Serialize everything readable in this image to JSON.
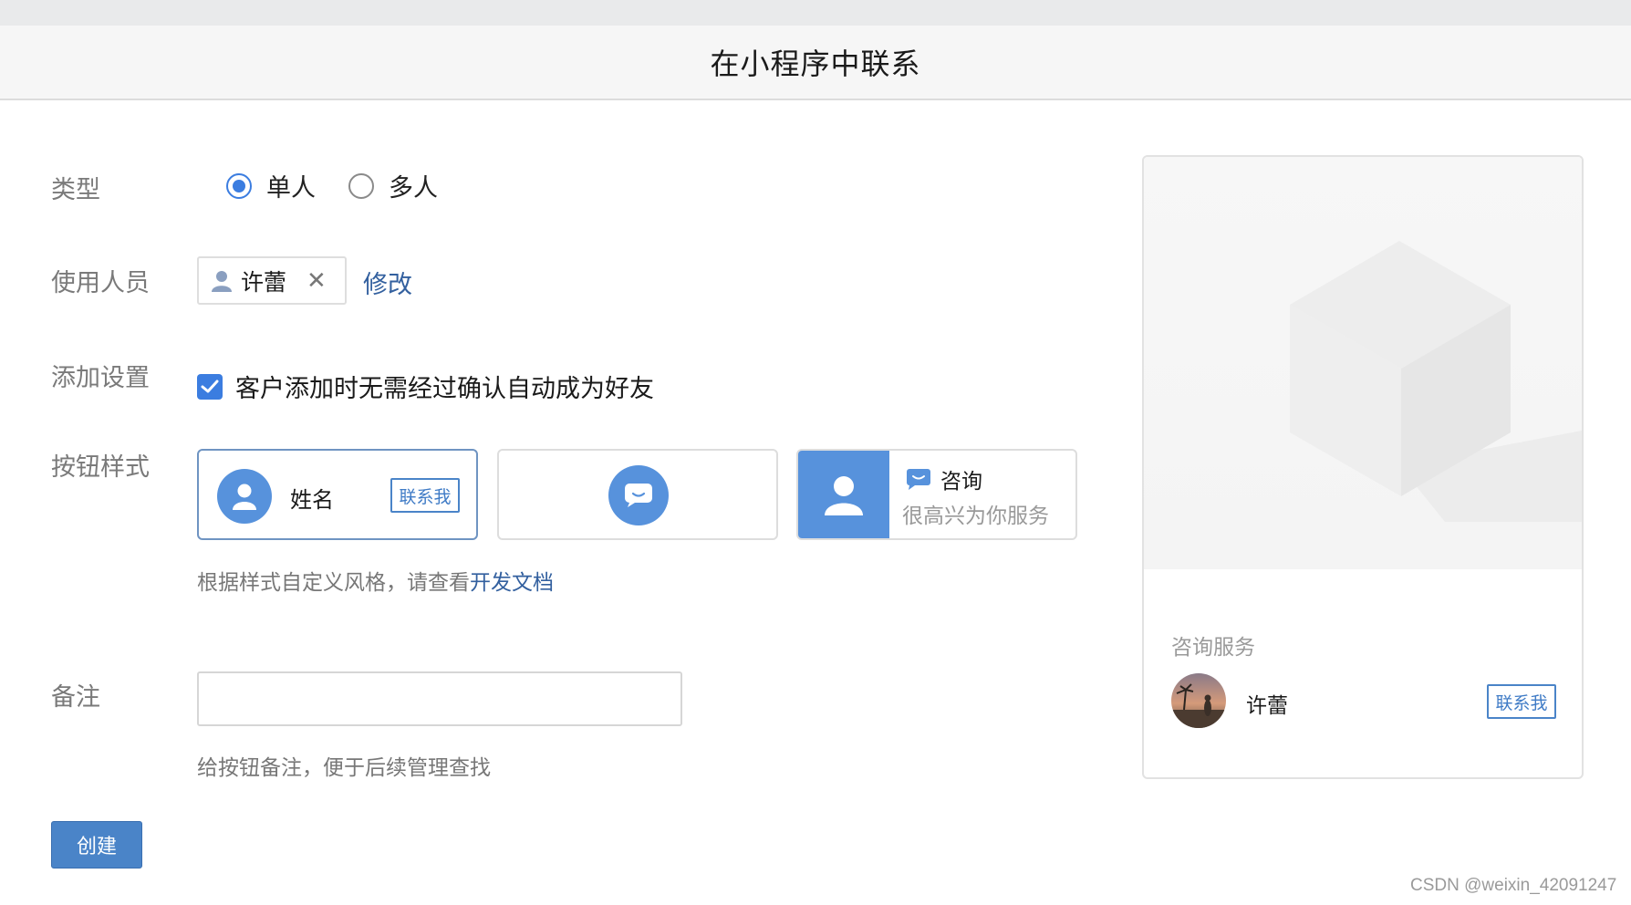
{
  "header": {
    "title": "在小程序中联系"
  },
  "form": {
    "type_label": "类型",
    "type_options": [
      {
        "label": "单人",
        "checked": true
      },
      {
        "label": "多人",
        "checked": false
      }
    ],
    "users_label": "使用人员",
    "user_chip": {
      "name": "许蕾",
      "icon": "user-icon",
      "remove_icon": "close-icon"
    },
    "modify_link": "修改",
    "add_settings_label": "添加设置",
    "auto_friend_checkbox": {
      "text": "客户添加时无需经过确认自动成为好友",
      "checked": true
    },
    "button_style_label": "按钮样式",
    "style_cards": {
      "card1": {
        "name": "姓名",
        "tag": "联系我"
      },
      "card3": {
        "title": "咨询",
        "subtitle": "很高兴为你服务"
      }
    },
    "hint_style": "根据样式自定义风格，请查看",
    "doc_link": "开发文档",
    "remark_label": "备注",
    "remark_value": "",
    "hint_remark": "给按钮备注，便于后续管理查找",
    "create_button": "创建"
  },
  "preview": {
    "service_label": "咨询服务",
    "person_name": "许蕾",
    "contact_tag": "联系我"
  },
  "watermark": "CSDN @weixin_42091247",
  "colors": {
    "accent": "#3b7de0",
    "button": "#4a84c8",
    "link": "#33609f"
  }
}
